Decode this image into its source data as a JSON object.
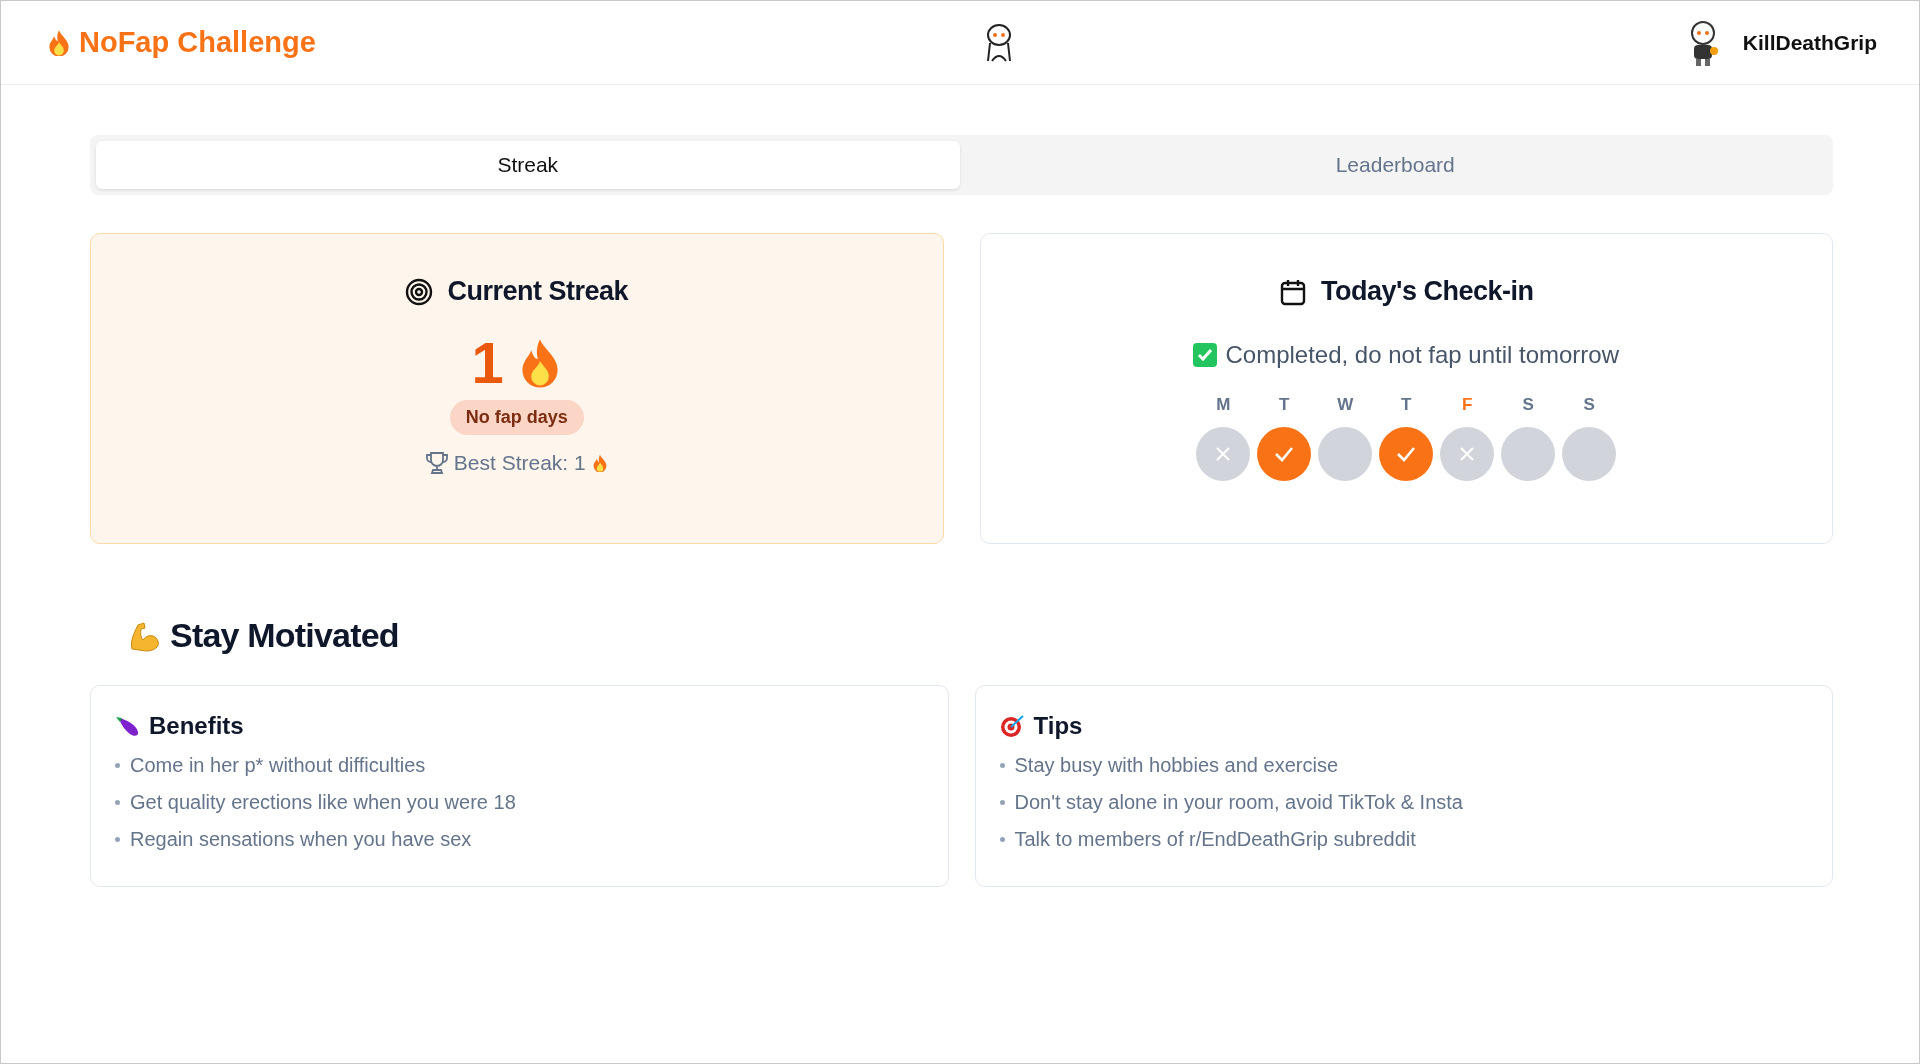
{
  "header": {
    "title": "NoFap Challenge",
    "username": "KillDeathGrip"
  },
  "tabs": [
    {
      "label": "Streak",
      "selected": true
    },
    {
      "label": "Leaderboard",
      "selected": false
    }
  ],
  "streak_card": {
    "title": "Current Streak",
    "count": "1",
    "badge": "No fap days",
    "best_streak": "Best Streak: 1"
  },
  "checkin_card": {
    "title": "Today's Check-in",
    "status": "Completed, do not fap until tomorrow",
    "days": [
      {
        "label": "M",
        "kind": "missed",
        "today": false
      },
      {
        "label": "T",
        "kind": "done",
        "today": false
      },
      {
        "label": "W",
        "kind": "empty",
        "today": false
      },
      {
        "label": "T",
        "kind": "done",
        "today": false
      },
      {
        "label": "F",
        "kind": "missed",
        "today": true
      },
      {
        "label": "S",
        "kind": "empty",
        "today": false
      },
      {
        "label": "S",
        "kind": "empty",
        "today": false
      }
    ]
  },
  "motivation": {
    "title": "Stay Motivated",
    "cards": [
      {
        "kind": "benefits",
        "title": "Benefits",
        "items": [
          "Come in her p* without difficulties",
          "Get quality erections like when you were 18",
          "Regain sensations when you have sex"
        ]
      },
      {
        "kind": "tips",
        "title": "Tips",
        "items": [
          "Stay busy with hobbies and exercise",
          "Don't stay alone in your room, avoid TikTok & Insta",
          "Talk to members of r/EndDeathGrip subreddit"
        ]
      }
    ]
  }
}
